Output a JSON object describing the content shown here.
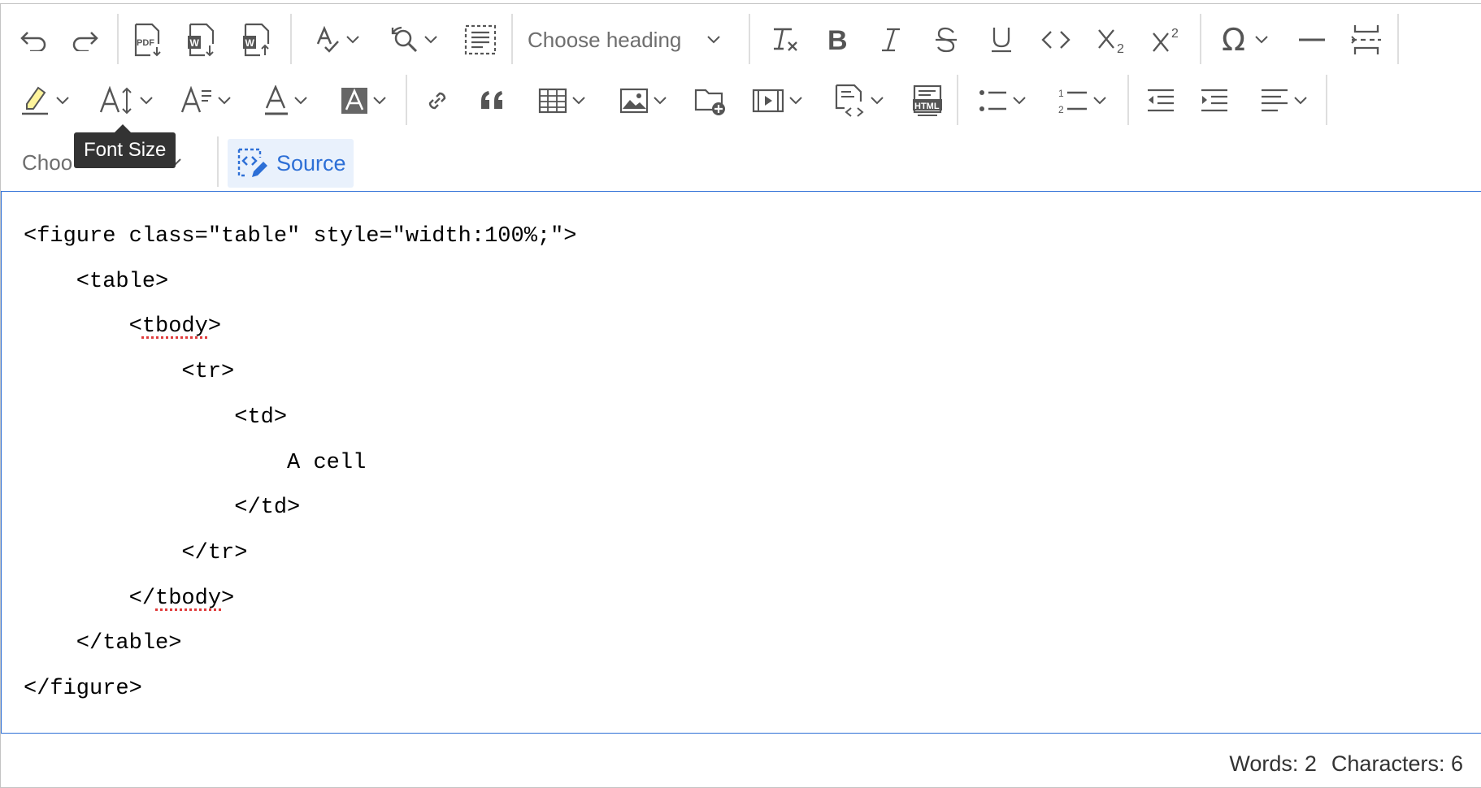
{
  "toolbar": {
    "heading_dropdown": "Choose heading",
    "font_dropdown_partial": "Choo",
    "source_label": "Source",
    "tooltip": "Font Size"
  },
  "source": {
    "lines": [
      "<figure class=\"table\" style=\"width:100%;\">",
      "    <table>",
      "        <tbody>",
      "            <tr>",
      "                <td>",
      "                    A cell",
      "                </td>",
      "            </tr>",
      "        </tbody>",
      "    </table>",
      "</figure>"
    ]
  },
  "status": {
    "words": "Words: 2",
    "characters": "Characters: 6"
  },
  "colors": {
    "accent": "#2d6fd6",
    "source_bg": "#e9f1fc",
    "icon": "#555555",
    "tooltip_bg": "#333333"
  }
}
